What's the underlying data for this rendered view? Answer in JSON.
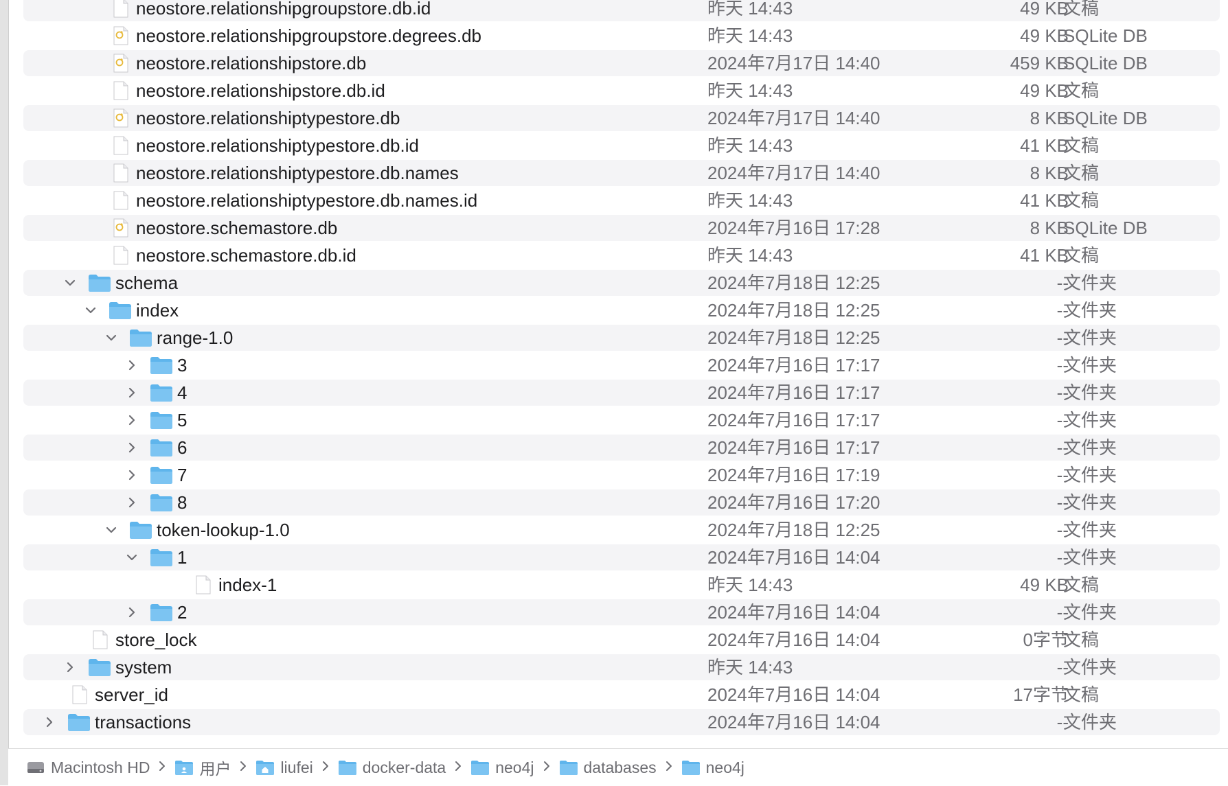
{
  "rows": [
    {
      "name": "neostore.relationshipgroupstore.db.id",
      "date": "昨天 14:43",
      "size": "49 KB",
      "kind": "文稿",
      "icon": "document-icon",
      "level": 4,
      "toggle": ""
    },
    {
      "name": "neostore.relationshipgroupstore.degrees.db",
      "date": "昨天 14:43",
      "size": "49 KB",
      "kind": "SQLite DB",
      "icon": "sqlite-db-icon",
      "level": 4,
      "toggle": ""
    },
    {
      "name": "neostore.relationshipstore.db",
      "date": "2024年7月17日 14:40",
      "size": "459 KB",
      "kind": "SQLite DB",
      "icon": "sqlite-db-icon",
      "level": 4,
      "toggle": ""
    },
    {
      "name": "neostore.relationshipstore.db.id",
      "date": "昨天 14:43",
      "size": "49 KB",
      "kind": "文稿",
      "icon": "document-icon",
      "level": 4,
      "toggle": ""
    },
    {
      "name": "neostore.relationshiptypestore.db",
      "date": "2024年7月17日 14:40",
      "size": "8 KB",
      "kind": "SQLite DB",
      "icon": "sqlite-db-icon",
      "level": 4,
      "toggle": ""
    },
    {
      "name": "neostore.relationshiptypestore.db.id",
      "date": "昨天 14:43",
      "size": "41 KB",
      "kind": "文稿",
      "icon": "document-icon",
      "level": 4,
      "toggle": ""
    },
    {
      "name": "neostore.relationshiptypestore.db.names",
      "date": "2024年7月17日 14:40",
      "size": "8 KB",
      "kind": "文稿",
      "icon": "document-icon",
      "level": 4,
      "toggle": ""
    },
    {
      "name": "neostore.relationshiptypestore.db.names.id",
      "date": "昨天 14:43",
      "size": "41 KB",
      "kind": "文稿",
      "icon": "document-icon",
      "level": 4,
      "toggle": ""
    },
    {
      "name": "neostore.schemastore.db",
      "date": "2024年7月16日 17:28",
      "size": "8 KB",
      "kind": "SQLite DB",
      "icon": "sqlite-db-icon",
      "level": 4,
      "toggle": ""
    },
    {
      "name": "neostore.schemastore.db.id",
      "date": "昨天 14:43",
      "size": "41 KB",
      "kind": "文稿",
      "icon": "document-icon",
      "level": 4,
      "toggle": ""
    },
    {
      "name": "schema",
      "date": "2024年7月18日 12:25",
      "size": "--",
      "kind": "文件夹",
      "icon": "folder-icon",
      "level": 3,
      "toggle": "expanded"
    },
    {
      "name": "index",
      "date": "2024年7月18日 12:25",
      "size": "--",
      "kind": "文件夹",
      "icon": "folder-icon",
      "level": 4,
      "toggle": "expanded"
    },
    {
      "name": "range-1.0",
      "date": "2024年7月18日 12:25",
      "size": "--",
      "kind": "文件夹",
      "icon": "folder-icon",
      "level": 5,
      "toggle": "expanded"
    },
    {
      "name": "3",
      "date": "2024年7月16日 17:17",
      "size": "--",
      "kind": "文件夹",
      "icon": "folder-icon",
      "level": 6,
      "toggle": "collapsed"
    },
    {
      "name": "4",
      "date": "2024年7月16日 17:17",
      "size": "--",
      "kind": "文件夹",
      "icon": "folder-icon",
      "level": 6,
      "toggle": "collapsed"
    },
    {
      "name": "5",
      "date": "2024年7月16日 17:17",
      "size": "--",
      "kind": "文件夹",
      "icon": "folder-icon",
      "level": 6,
      "toggle": "collapsed"
    },
    {
      "name": "6",
      "date": "2024年7月16日 17:17",
      "size": "--",
      "kind": "文件夹",
      "icon": "folder-icon",
      "level": 6,
      "toggle": "collapsed"
    },
    {
      "name": "7",
      "date": "2024年7月16日 17:19",
      "size": "--",
      "kind": "文件夹",
      "icon": "folder-icon",
      "level": 6,
      "toggle": "collapsed"
    },
    {
      "name": "8",
      "date": "2024年7月16日 17:20",
      "size": "--",
      "kind": "文件夹",
      "icon": "folder-icon",
      "level": 6,
      "toggle": "collapsed"
    },
    {
      "name": "token-lookup-1.0",
      "date": "2024年7月18日 12:25",
      "size": "--",
      "kind": "文件夹",
      "icon": "folder-icon",
      "level": 5,
      "toggle": "expanded"
    },
    {
      "name": "1",
      "date": "2024年7月16日 14:04",
      "size": "--",
      "kind": "文件夹",
      "icon": "folder-icon",
      "level": 6,
      "toggle": "expanded"
    },
    {
      "name": "index-1",
      "date": "昨天 14:43",
      "size": "49 KB",
      "kind": "文稿",
      "icon": "document-icon",
      "level": 8,
      "toggle": ""
    },
    {
      "name": "2",
      "date": "2024年7月16日 14:04",
      "size": "--",
      "kind": "文件夹",
      "icon": "folder-icon",
      "level": 6,
      "toggle": "collapsed"
    },
    {
      "name": "store_lock",
      "date": "2024年7月16日 14:04",
      "size": "0字节",
      "kind": "文稿",
      "icon": "document-icon",
      "level": 3,
      "toggle": ""
    },
    {
      "name": "system",
      "date": "昨天 14:43",
      "size": "--",
      "kind": "文件夹",
      "icon": "folder-icon",
      "level": 3,
      "toggle": "collapsed"
    },
    {
      "name": "server_id",
      "date": "2024年7月16日 14:04",
      "size": "17字节",
      "kind": "文稿",
      "icon": "document-icon",
      "level": 2,
      "toggle": ""
    },
    {
      "name": "transactions",
      "date": "2024年7月16日 14:04",
      "size": "--",
      "kind": "文件夹",
      "icon": "folder-icon",
      "level": 2,
      "toggle": "collapsed"
    }
  ],
  "pathbar": [
    {
      "label": "Macintosh HD",
      "icon": "hard-drive-icon"
    },
    {
      "label": "用户",
      "icon": "users-folder-icon"
    },
    {
      "label": "liufei",
      "icon": "home-folder-icon"
    },
    {
      "label": "docker-data",
      "icon": "folder-icon"
    },
    {
      "label": "neo4j",
      "icon": "folder-icon"
    },
    {
      "label": "databases",
      "icon": "folder-icon"
    },
    {
      "label": "neo4j",
      "icon": "folder-icon"
    }
  ],
  "colors": {
    "folder": "#5fb5ec",
    "folder_tab": "#7cc4f2",
    "alt_row": "#f4f4f6",
    "secondary_text": "#6e6e73",
    "sqlite_badge": "#e7b93a"
  }
}
